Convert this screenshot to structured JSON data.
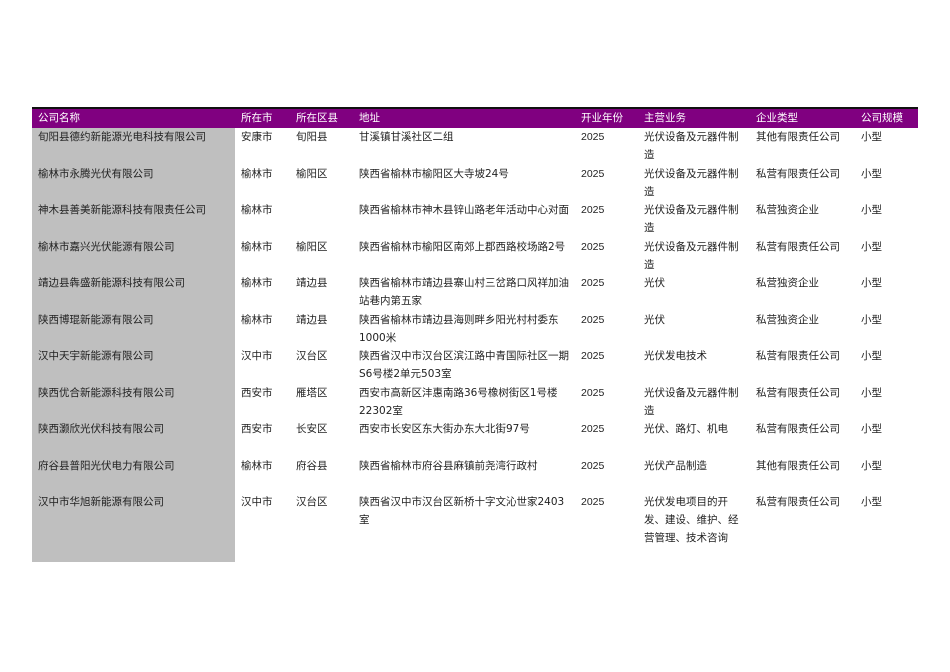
{
  "table": {
    "headers": [
      "公司名称",
      "所在市",
      "所在区县",
      "地址",
      "开业年份",
      "主营业务",
      "企业类型",
      "公司规模"
    ],
    "rows": [
      [
        "旬阳县德约新能源光电科技有限公司",
        "安康市",
        "旬阳县",
        "甘溪镇甘溪社区二组",
        "2025",
        "光伏设备及元器件制造",
        "其他有限责任公司",
        "小型"
      ],
      [
        "榆林市永腾光伏有限公司",
        "榆林市",
        "榆阳区",
        "陕西省榆林市榆阳区大寺坡24号",
        "2025",
        "光伏设备及元器件制造",
        "私营有限责任公司",
        "小型"
      ],
      [
        "神木县善美新能源科技有限责任公司",
        "榆林市",
        "",
        "陕西省榆林市神木县锌山路老年活动中心对面",
        "2025",
        "光伏设备及元器件制造",
        "私营独资企业",
        "小型"
      ],
      [
        "榆林市嘉兴光伏能源有限公司",
        "榆林市",
        "榆阳区",
        "陕西省榆林市榆阳区南郊上郡西路校场路2号",
        "2025",
        "光伏设备及元器件制造",
        "私营有限责任公司",
        "小型"
      ],
      [
        "靖边县犇盛新能源科技有限公司",
        "榆林市",
        "靖边县",
        "陕西省榆林市靖边县寨山村三岔路口风祥加油站巷内第五家",
        "2025",
        "光伏",
        "私营独资企业",
        "小型"
      ],
      [
        "陕西博琨新能源有限公司",
        "榆林市",
        "靖边县",
        "陕西省榆林市靖边县海则畔乡阳光村村委东1000米",
        "2025",
        "光伏",
        "私营独资企业",
        "小型"
      ],
      [
        "汉中天宇新能源有限公司",
        "汉中市",
        "汉台区",
        "陕西省汉中市汉台区滨江路中青国际社区一期S6号楼2单元503室",
        "2025",
        "光伏发电技术",
        "私营有限责任公司",
        "小型"
      ],
      [
        "陕西优合新能源科技有限公司",
        "西安市",
        "雁塔区",
        "西安市高新区沣惠南路36号橡树街区1号楼22302室",
        "2025",
        "光伏设备及元器件制造",
        "私营有限责任公司",
        "小型"
      ],
      [
        "陕西灏欣光伏科技有限公司",
        "西安市",
        "长安区",
        "西安市长安区东大街办东大北街97号",
        "2025",
        "光伏、路灯、机电",
        "私营有限责任公司",
        "小型"
      ],
      [
        "府谷县普阳光伏电力有限公司",
        "榆林市",
        "府谷县",
        "陕西省榆林市府谷县麻镇前尧湾行政村",
        "2025",
        "光伏产品制造",
        "其他有限责任公司",
        "小型"
      ],
      [
        "汉中市华旭新能源有限公司",
        "汉中市",
        "汉台区",
        "陕西省汉中市汉台区新桥十字文沁世家2403室",
        "2025",
        "光伏发电项目的开发、建设、维护、经营管理、技术咨询",
        "私营有限责任公司",
        "小型"
      ]
    ]
  }
}
